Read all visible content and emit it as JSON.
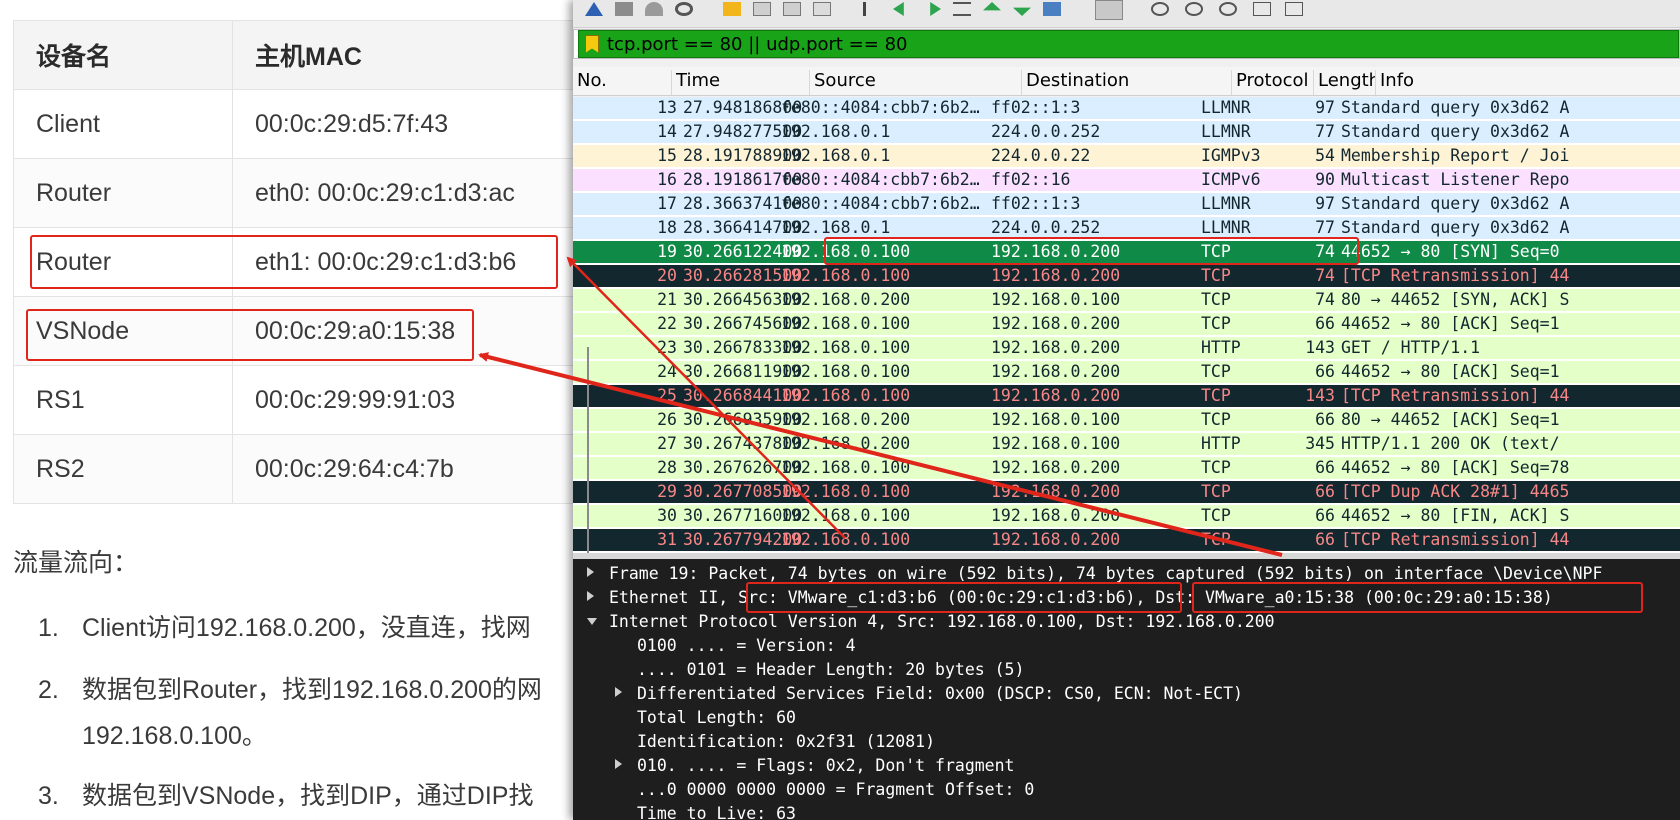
{
  "doc": {
    "table": {
      "headers": [
        "设备名",
        "主机MAC"
      ],
      "rows": [
        [
          "Client",
          "00:0c:29:d5:7f:43"
        ],
        [
          "Router",
          "eth0:  00:0c:29:c1:d3:ac"
        ],
        [
          "Router",
          "eth1:  00:0c:29:c1:d3:b6"
        ],
        [
          "VSNode",
          "00:0c:29:a0:15:38"
        ],
        [
          "RS1",
          "00:0c:29:99:91:03"
        ],
        [
          "RS2",
          "00:0c:29:64:c4:7b"
        ]
      ]
    },
    "flow_title": "流量流向：",
    "steps": [
      {
        "num": "1.",
        "text": "Client访问192.168.0.200，没直连，找网"
      },
      {
        "num": "2.",
        "text": "数据包到Router，找到192.168.0.200的网"
      },
      {
        "num": "",
        "text": "192.168.0.100。"
      },
      {
        "num": "3.",
        "text": "数据包到VSNode，找到DIP，通过DIP找"
      }
    ]
  },
  "wireshark": {
    "filter": "tcp.port == 80 || udp.port == 80",
    "columns": [
      "No.",
      "Time",
      "Source",
      "Destination",
      "Protocol",
      "Length",
      "Info"
    ],
    "packets": [
      {
        "no": "13",
        "time": "27.948186800",
        "src": "fe80::4084:cbb7:6b2…",
        "dst": "ff02::1:3",
        "proto": "LLMNR",
        "len": "97",
        "info": "Standard query 0x3d62 A",
        "style": "llmnr"
      },
      {
        "no": "14",
        "time": "27.948277500",
        "src": "192.168.0.1",
        "dst": "224.0.0.252",
        "proto": "LLMNR",
        "len": "77",
        "info": "Standard query 0x3d62 A",
        "style": "llmnr"
      },
      {
        "no": "15",
        "time": "28.191788900",
        "src": "192.168.0.1",
        "dst": "224.0.0.22",
        "proto": "IGMPv3",
        "len": "54",
        "info": "Membership Report / Joi",
        "style": "igmp"
      },
      {
        "no": "16",
        "time": "28.191861700",
        "src": "fe80::4084:cbb7:6b2…",
        "dst": "ff02::16",
        "proto": "ICMPv6",
        "len": "90",
        "info": "Multicast Listener Repo",
        "style": "icmp"
      },
      {
        "no": "17",
        "time": "28.366374100",
        "src": "fe80::4084:cbb7:6b2…",
        "dst": "ff02::1:3",
        "proto": "LLMNR",
        "len": "97",
        "info": "Standard query 0x3d62 A",
        "style": "llmnr"
      },
      {
        "no": "18",
        "time": "28.366414700",
        "src": "192.168.0.1",
        "dst": "224.0.0.252",
        "proto": "LLMNR",
        "len": "77",
        "info": "Standard query 0x3d62 A",
        "style": "llmnr"
      },
      {
        "no": "19",
        "time": "30.266122400",
        "src": "192.168.0.100",
        "dst": "192.168.0.200",
        "proto": "TCP",
        "len": "74",
        "info": "44652 → 80 [SYN] Seq=0",
        "style": "selected"
      },
      {
        "no": "20",
        "time": "30.266281500",
        "src": "192.168.0.100",
        "dst": "192.168.0.200",
        "proto": "TCP",
        "len": "74",
        "info": "[TCP Retransmission] 44",
        "style": "bad"
      },
      {
        "no": "21",
        "time": "30.266456300",
        "src": "192.168.0.200",
        "dst": "192.168.0.100",
        "proto": "TCP",
        "len": "74",
        "info": "80 → 44652 [SYN, ACK] S",
        "style": "tcp"
      },
      {
        "no": "22",
        "time": "30.266745600",
        "src": "192.168.0.100",
        "dst": "192.168.0.200",
        "proto": "TCP",
        "len": "66",
        "info": "44652 → 80 [ACK] Seq=1",
        "style": "tcp"
      },
      {
        "no": "23",
        "time": "30.266783300",
        "src": "192.168.0.100",
        "dst": "192.168.0.200",
        "proto": "HTTP",
        "len": "143",
        "info": "GET / HTTP/1.1",
        "style": "tcp"
      },
      {
        "no": "24",
        "time": "30.266811900",
        "src": "192.168.0.100",
        "dst": "192.168.0.200",
        "proto": "TCP",
        "len": "66",
        "info": "44652 → 80 [ACK] Seq=1",
        "style": "tcp"
      },
      {
        "no": "25",
        "time": "30.266844100",
        "src": "192.168.0.100",
        "dst": "192.168.0.200",
        "proto": "TCP",
        "len": "143",
        "info": "[TCP Retransmission] 44",
        "style": "bad"
      },
      {
        "no": "26",
        "time": "30.266935900",
        "src": "192.168.0.200",
        "dst": "192.168.0.100",
        "proto": "TCP",
        "len": "66",
        "info": "80 → 44652 [ACK] Seq=1",
        "style": "tcp"
      },
      {
        "no": "27",
        "time": "30.267437800",
        "src": "192.168.0.200",
        "dst": "192.168.0.100",
        "proto": "HTTP",
        "len": "345",
        "info": "HTTP/1.1 200 OK  (text/",
        "style": "tcp"
      },
      {
        "no": "28",
        "time": "30.267626700",
        "src": "192.168.0.100",
        "dst": "192.168.0.200",
        "proto": "TCP",
        "len": "66",
        "info": "44652 → 80 [ACK] Seq=78",
        "style": "tcp"
      },
      {
        "no": "29",
        "time": "30.267708500",
        "src": "192.168.0.100",
        "dst": "192.168.0.200",
        "proto": "TCP",
        "len": "66",
        "info": "[TCP Dup ACK 28#1] 4465",
        "style": "bad"
      },
      {
        "no": "30",
        "time": "30.267716000",
        "src": "192.168.0.100",
        "dst": "192.168.0.200",
        "proto": "TCP",
        "len": "66",
        "info": "44652 → 80 [FIN, ACK] S",
        "style": "tcp"
      },
      {
        "no": "31",
        "time": "30.267794200",
        "src": "192.168.0.100",
        "dst": "192.168.0.200",
        "proto": "TCP",
        "len": "66",
        "info": "[TCP Retransmission] 44",
        "style": "dark"
      }
    ],
    "details": [
      {
        "indent": 0,
        "expander": "right",
        "text": "Frame 19: Packet, 74 bytes on wire (592 bits), 74 bytes captured (592 bits) on interface \\Device\\NPF_"
      },
      {
        "indent": 0,
        "expander": "right",
        "text": "Ethernet II, Src: VMware_c1:d3:b6 (00:0c:29:c1:d3:b6), Dst: VMware_a0:15:38 (00:0c:29:a0:15:38)"
      },
      {
        "indent": 0,
        "expander": "down",
        "text": "Internet Protocol Version 4, Src: 192.168.0.100, Dst: 192.168.0.200"
      },
      {
        "indent": 1,
        "expander": "none",
        "text": "0100 .... = Version: 4"
      },
      {
        "indent": 1,
        "expander": "none",
        "text": ".... 0101 = Header Length: 20 bytes (5)"
      },
      {
        "indent": 1,
        "expander": "right",
        "text": "Differentiated Services Field: 0x00 (DSCP: CS0, ECN: Not-ECT)"
      },
      {
        "indent": 1,
        "expander": "none",
        "text": "Total Length: 60"
      },
      {
        "indent": 1,
        "expander": "none",
        "text": "Identification: 0x2f31 (12081)"
      },
      {
        "indent": 1,
        "expander": "right",
        "text": "010. .... = Flags: 0x2, Don't fragment"
      },
      {
        "indent": 1,
        "expander": "none",
        "text": "...0 0000 0000 0000 = Fragment Offset: 0"
      },
      {
        "indent": 1,
        "expander": "none",
        "text": "Time to Live: 63"
      }
    ]
  },
  "colors": {
    "llmnr": {
      "bg": "#daeeff",
      "fg": "#12272e"
    },
    "igmp": {
      "bg": "#fff3d6",
      "fg": "#12272e"
    },
    "icmp": {
      "bg": "#fce0ff",
      "fg": "#12272e"
    },
    "tcp": {
      "bg": "#e7e6ff",
      "fg": "#12272e"
    },
    "http": {
      "bg": "#e4ffc7",
      "fg": "#12272e"
    },
    "selected": {
      "bg": "#108a47",
      "fg": "#ffffff"
    },
    "bad": {
      "bg": "#12272e",
      "fg": "#f78787"
    },
    "dark": {
      "bg": "#12272e",
      "fg": "#f78787"
    },
    "annotation": "#e0251b"
  }
}
